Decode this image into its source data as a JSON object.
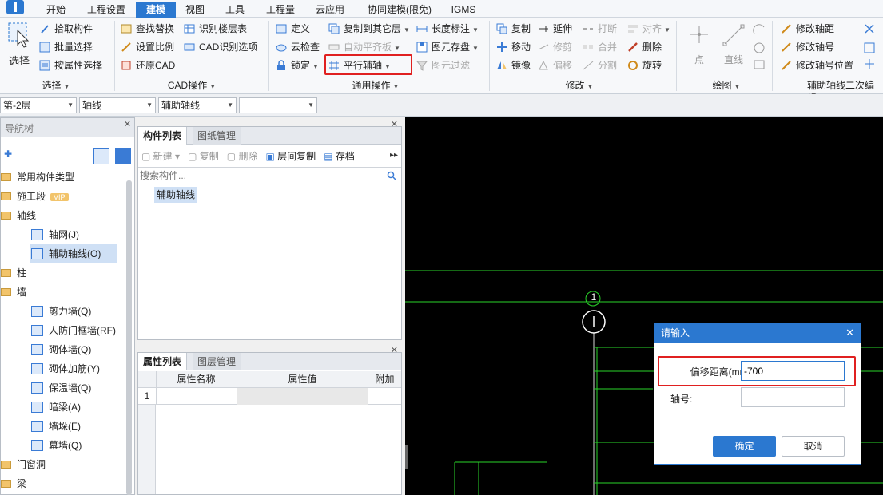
{
  "menubar": {
    "items": [
      "开始",
      "工程设置",
      "建模",
      "视图",
      "工具",
      "工程量",
      "云应用",
      "协同建模(限免)",
      "IGMS"
    ],
    "active": "建模"
  },
  "ribbon": {
    "select": {
      "big": "选择",
      "items": [
        "拾取构件",
        "批量选择",
        "按属性选择"
      ],
      "group": "选择"
    },
    "cad": {
      "items": [
        "查找替换",
        "识别楼层表",
        "设置比例",
        "CAD识别选项",
        "还原CAD"
      ],
      "group": "CAD操作"
    },
    "general": {
      "items": [
        "定义",
        "复制到其它层",
        "长度标注",
        "云检查",
        "自动平齐板",
        "图元存盘",
        "锁定",
        "平行辅轴",
        "图元过滤"
      ],
      "group": "通用操作"
    },
    "modify": {
      "items": [
        "复制",
        "延伸",
        "打断",
        "对齐",
        "移动",
        "修剪",
        "合并",
        "删除",
        "镜像",
        "偏移",
        "分割",
        "旋转"
      ],
      "group": "修改"
    },
    "draw": {
      "items": [
        "点",
        "直线"
      ],
      "group": "绘图"
    },
    "axis": {
      "items": [
        "修改轴距",
        "修改轴号",
        "修改轴号位置"
      ],
      "group": "辅助轴线二次编辑"
    }
  },
  "selectors": {
    "floor": "第-2层",
    "type": "轴线",
    "sub": "辅助轴线",
    "extra": ""
  },
  "nav": {
    "title": "导航树",
    "items": [
      {
        "label": "常用构件类型",
        "level": 0
      },
      {
        "label": "施工段",
        "level": 0,
        "badge": "VIP"
      },
      {
        "label": "轴线",
        "level": 0
      },
      {
        "label": "轴网(J)",
        "level": 1
      },
      {
        "label": "辅助轴线(O)",
        "level": 1,
        "selected": true
      },
      {
        "label": "柱",
        "level": 0
      },
      {
        "label": "墙",
        "level": 0
      },
      {
        "label": "剪力墙(Q)",
        "level": 1
      },
      {
        "label": "人防门框墙(RF)",
        "level": 1
      },
      {
        "label": "砌体墙(Q)",
        "level": 1
      },
      {
        "label": "砌体加筋(Y)",
        "level": 1
      },
      {
        "label": "保温墙(Q)",
        "level": 1
      },
      {
        "label": "暗梁(A)",
        "level": 1
      },
      {
        "label": "墙垛(E)",
        "level": 1
      },
      {
        "label": "幕墙(Q)",
        "level": 1
      },
      {
        "label": "门窗洞",
        "level": 0
      },
      {
        "label": "梁",
        "level": 0
      }
    ]
  },
  "components": {
    "tabs": [
      "构件列表",
      "图纸管理"
    ],
    "toolbar": [
      "新建",
      "复制",
      "删除",
      "层间复制",
      "存档"
    ],
    "search_placeholder": "搜索构件...",
    "list": [
      "辅助轴线"
    ]
  },
  "properties": {
    "tabs": [
      "属性列表",
      "图层管理"
    ],
    "columns": [
      "属性名称",
      "属性值",
      "附加"
    ],
    "rows": [
      {
        "index": "1",
        "name": "",
        "value": "",
        "extra": ""
      }
    ]
  },
  "canvas": {
    "axis_label": "1"
  },
  "dialog": {
    "title": "请输入",
    "offset_label": "偏移距离(mm):",
    "offset_value": "-700",
    "axis_label": "轴号:",
    "axis_value": "",
    "ok": "确定",
    "cancel": "取消"
  },
  "colors": {
    "accent": "#2b78d0",
    "highlight": "#e02020",
    "cad_line": "#22dd22"
  }
}
